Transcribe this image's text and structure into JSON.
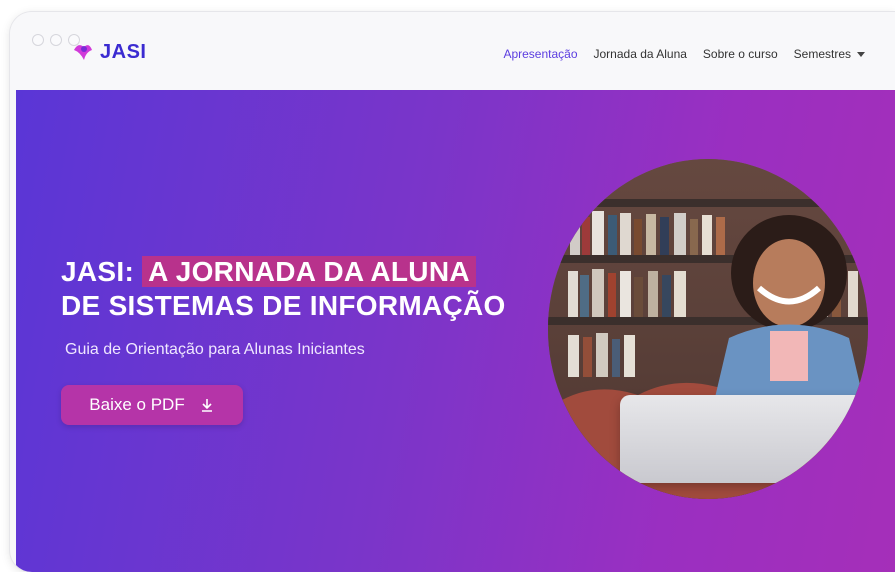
{
  "header": {
    "brand": "JASI",
    "nav": [
      {
        "label": "Apresentação",
        "active": true
      },
      {
        "label": "Jornada da Aluna",
        "active": false
      },
      {
        "label": "Sobre o curso",
        "active": false
      },
      {
        "label": "Semestres",
        "active": false,
        "dropdown": true
      }
    ]
  },
  "hero": {
    "title_prefix": "JASI:",
    "title_highlight": "A JORNADA DA ALUNA",
    "title_line2": "DE SISTEMAS DE INFORMAÇÃO",
    "subtitle": "Guia de Orientação para Alunas Iniciantes",
    "cta_label": "Baixe o PDF",
    "cta_icon": "download-icon",
    "image_alt": "student-photo"
  },
  "colors": {
    "brand": "#3b2bd1",
    "nav_active": "#5b3de0",
    "hero_start": "#5a36d6",
    "hero_end": "#a52fb9",
    "highlight": "#b8328c",
    "button": "#b534a8"
  }
}
